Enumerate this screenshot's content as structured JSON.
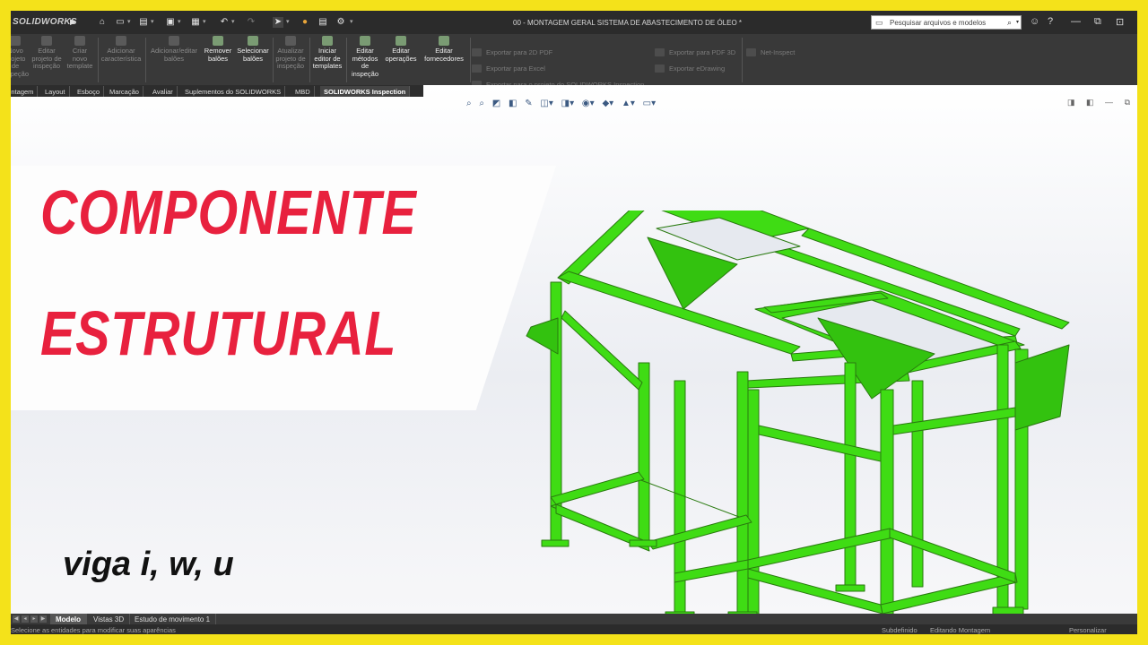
{
  "titlebar": {
    "app_logo": "SOLIDWORKS",
    "document_title": "00 - MONTAGEM GERAL SISTEMA DE ABASTECIMENTO DE ÓLEO *",
    "search_placeholder": "Pesquisar arquivos e modelos"
  },
  "ribbon": {
    "buttons": [
      {
        "label": "Novo projeto de inspeção"
      },
      {
        "label": "Editar projeto de inspeção"
      },
      {
        "label": "Criar novo template"
      },
      {
        "label": "Adicionar característica"
      },
      {
        "label": "Adicionar/editar balões"
      },
      {
        "label": "Remover balões"
      },
      {
        "label": "Selecionar balões"
      },
      {
        "label": "Atualizar projeto de inspeção"
      },
      {
        "label": "Iniciar editor de templates"
      },
      {
        "label": "Editar métodos de inspeção"
      },
      {
        "label": "Editar operações"
      },
      {
        "label": "Editar fornecedores"
      }
    ],
    "exports": [
      {
        "label": "Exportar para 2D PDF"
      },
      {
        "label": "Exportar para Excel"
      },
      {
        "label": "Exportar para o projeto do SOLIDWORKS Inspection"
      },
      {
        "label": "Exportar para PDF 3D"
      },
      {
        "label": "Exportar eDrawing"
      },
      {
        "label": "Net-Inspect"
      }
    ]
  },
  "tabs": [
    {
      "label": "Montagem"
    },
    {
      "label": "Layout"
    },
    {
      "label": "Esboço"
    },
    {
      "label": "Marcação"
    },
    {
      "label": "Avaliar"
    },
    {
      "label": "Suplementos do SOLIDWORKS"
    },
    {
      "label": "MBD"
    },
    {
      "label": "SOLIDWORKS Inspection"
    }
  ],
  "active_tab": "SOLIDWORKS Inspection",
  "overlay": {
    "title_line1": "COMPONENTE",
    "title_line2": "ESTRUTURAL",
    "subtitle": "viga i, w, u"
  },
  "model_tabs": [
    {
      "label": "Modelo"
    },
    {
      "label": "Vistas 3D"
    },
    {
      "label": "Estudo de movimento 1"
    }
  ],
  "status": {
    "hint": "Selecione as entidades para modificar suas aparências",
    "state": "Subdefinido",
    "mode": "Editando Montagem",
    "custom": "Personalizar"
  },
  "colors": {
    "frame_border": "#f4e21a",
    "title_red": "#e8213e",
    "structure_green": "#3fdc14",
    "ui_dark": "#393939"
  },
  "icons": [
    "home-icon",
    "new-file-icon",
    "open-icon",
    "save-icon",
    "print-icon",
    "undo-icon",
    "redo-icon",
    "select-arrow-icon",
    "traffic-light-icon",
    "file-properties-icon",
    "gear-icon",
    "search-icon",
    "user-icon",
    "help-icon",
    "minimize-icon",
    "restore-icon",
    "close-icon"
  ]
}
